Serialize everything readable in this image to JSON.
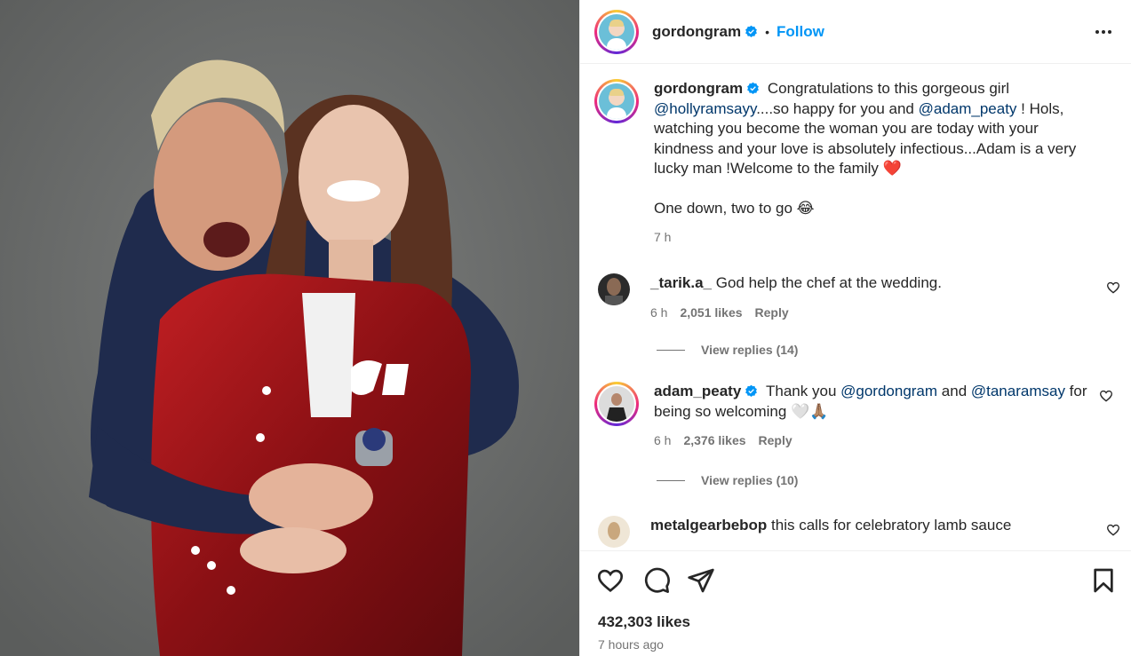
{
  "post": {
    "username": "gordongram",
    "follow_label": "Follow",
    "separator": "•"
  },
  "caption": {
    "username": "gordongram",
    "text_1": "Congratulations to this gorgeous girl ",
    "mention_1": "@hollyramsayy",
    "text_2": "....so happy for you and ",
    "mention_2": "@adam_peaty",
    "text_3": " ! Hols, watching you become the woman you are today with your kindness and your love is absolutely infectious...Adam is a very lucky man !Welcome to the family ❤️",
    "text_4": "One down, two to go 😂",
    "time": "7 h"
  },
  "comments": [
    {
      "username": "_tarik.a_",
      "text": "God help the chef at the wedding.",
      "time": "6 h",
      "likes": "2,051 likes",
      "reply_label": "Reply",
      "view_replies": "View replies (14)"
    },
    {
      "username": "adam_peaty",
      "text_1": "Thank you ",
      "mention_1": "@gordongram",
      "text_2": " and ",
      "mention_2": "@tanaramsay",
      "text_3": " for being so welcoming 🤍🙏🏽",
      "time": "6 h",
      "likes": "2,376 likes",
      "reply_label": "Reply",
      "view_replies": "View replies (10)"
    },
    {
      "username": "metalgearbebop",
      "text": "this calls for celebratory lamb sauce"
    }
  ],
  "footer": {
    "likes": "432,303 likes",
    "ago": "7 hours ago"
  },
  "icons": {
    "like": "heart-icon",
    "comment": "comment-icon",
    "share": "share-icon",
    "save": "bookmark-icon",
    "more": "more-options-icon",
    "verified": "verified-badge-icon"
  },
  "colors": {
    "accent": "#0095f6",
    "mention": "#00376b",
    "muted": "#737373",
    "text": "#262626"
  }
}
